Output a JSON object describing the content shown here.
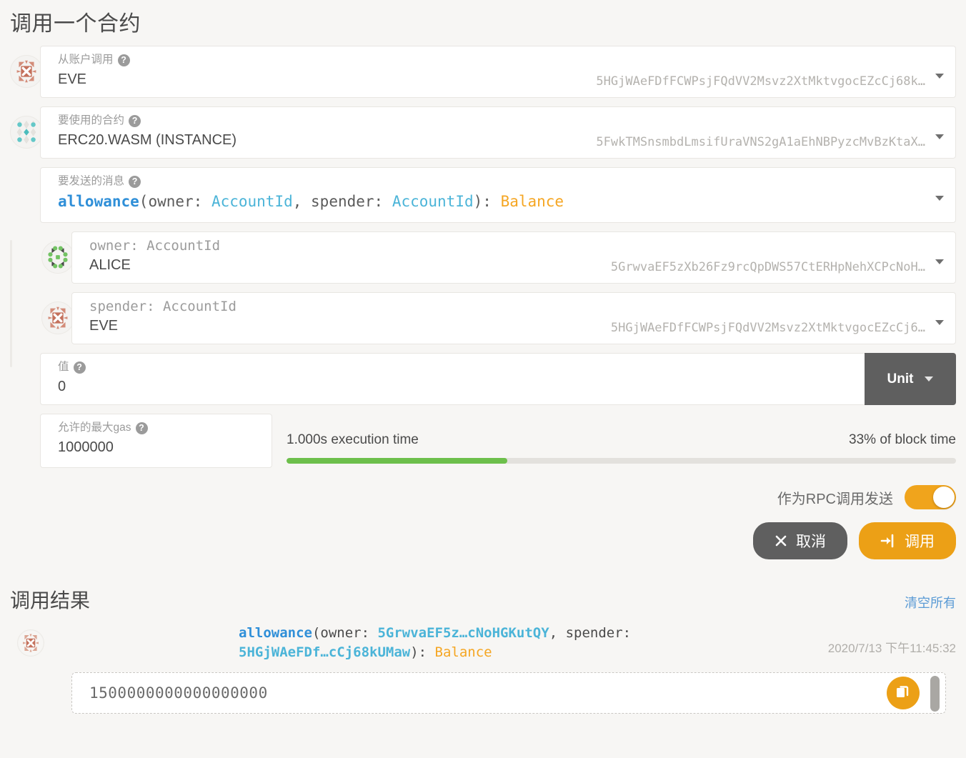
{
  "page": {
    "title": "调用一个合约"
  },
  "form": {
    "from_account": {
      "label": "从账户调用",
      "help": "?",
      "value": "EVE",
      "address": "5HGjWAeFDfFCWPsjFQdVV2Msvz2XtMktvgocEZcCj68k…",
      "icon": "eve-identicon",
      "caret": "chevron-down-icon"
    },
    "contract": {
      "label": "要使用的合约",
      "help": "?",
      "value": "ERC20.WASM (INSTANCE)",
      "address": "5FwkTMSnsmbdLmsifUraVNS2gA1aEhNBPyzcMvBzKtaX…",
      "icon": "contract-identicon",
      "caret": "chevron-down-icon"
    },
    "message": {
      "label": "要发送的消息",
      "help": "?",
      "signature": {
        "fn": "allowance",
        "open": "(owner: ",
        "type1": "AccountId",
        "sep": ", spender: ",
        "type2": "AccountId",
        "close": "): ",
        "ret": "Balance"
      },
      "caret": "chevron-down-icon"
    },
    "args": [
      {
        "label": "owner: AccountId",
        "value": "ALICE",
        "address": "5GrwvaEF5zXb26Fz9rcQpDWS57CtERHpNehXCPcNoH…",
        "icon": "alice-identicon",
        "caret": "chevron-down-icon"
      },
      {
        "label": "spender: AccountId",
        "value": "EVE",
        "address": "5HGjWAeFDfFCWPsjFQdVV2Msvz2XtMktvgocEZcCj6…",
        "icon": "eve-identicon",
        "caret": "chevron-down-icon"
      }
    ],
    "value_field": {
      "label": "值",
      "help": "?",
      "value": "0",
      "unit_label": "Unit",
      "unit_caret": "chevron-down-icon"
    },
    "gas": {
      "label": "允许的最大gas",
      "help": "?",
      "value": "1000000"
    },
    "execution": {
      "time_label": "1.000s execution time",
      "block_label": "33% of block time",
      "percent": 33,
      "fill_color": "#6dbf4b",
      "track_color": "#e3e1dd"
    },
    "rpc_toggle": {
      "label": "作为RPC调用发送",
      "state": "on",
      "on_color": "#f0a41c"
    },
    "buttons": {
      "cancel": {
        "label": "取消",
        "icon": "close-icon",
        "color": "#5f5f5f"
      },
      "call": {
        "label": "调用",
        "icon": "sign-in-icon",
        "color": "#eca016"
      }
    }
  },
  "results": {
    "title": "调用结果",
    "clear_all": "清空所有",
    "entries": [
      {
        "icon": "eve-identicon",
        "signature": {
          "fn": "allowance",
          "open": "(owner: ",
          "owner": "5GrwvaEF5z…cNoHGKutQY",
          "sep": ", spender: ",
          "spender": "5HGjWAeFDf…cCj68kUMaw",
          "close": "): ",
          "ret": "Balance"
        },
        "timestamp": "2020/7/13 下午11:45:32",
        "value": "1500000000000000000",
        "copy_icon": "copy-icon",
        "copy_color": "#eca016"
      }
    ]
  }
}
